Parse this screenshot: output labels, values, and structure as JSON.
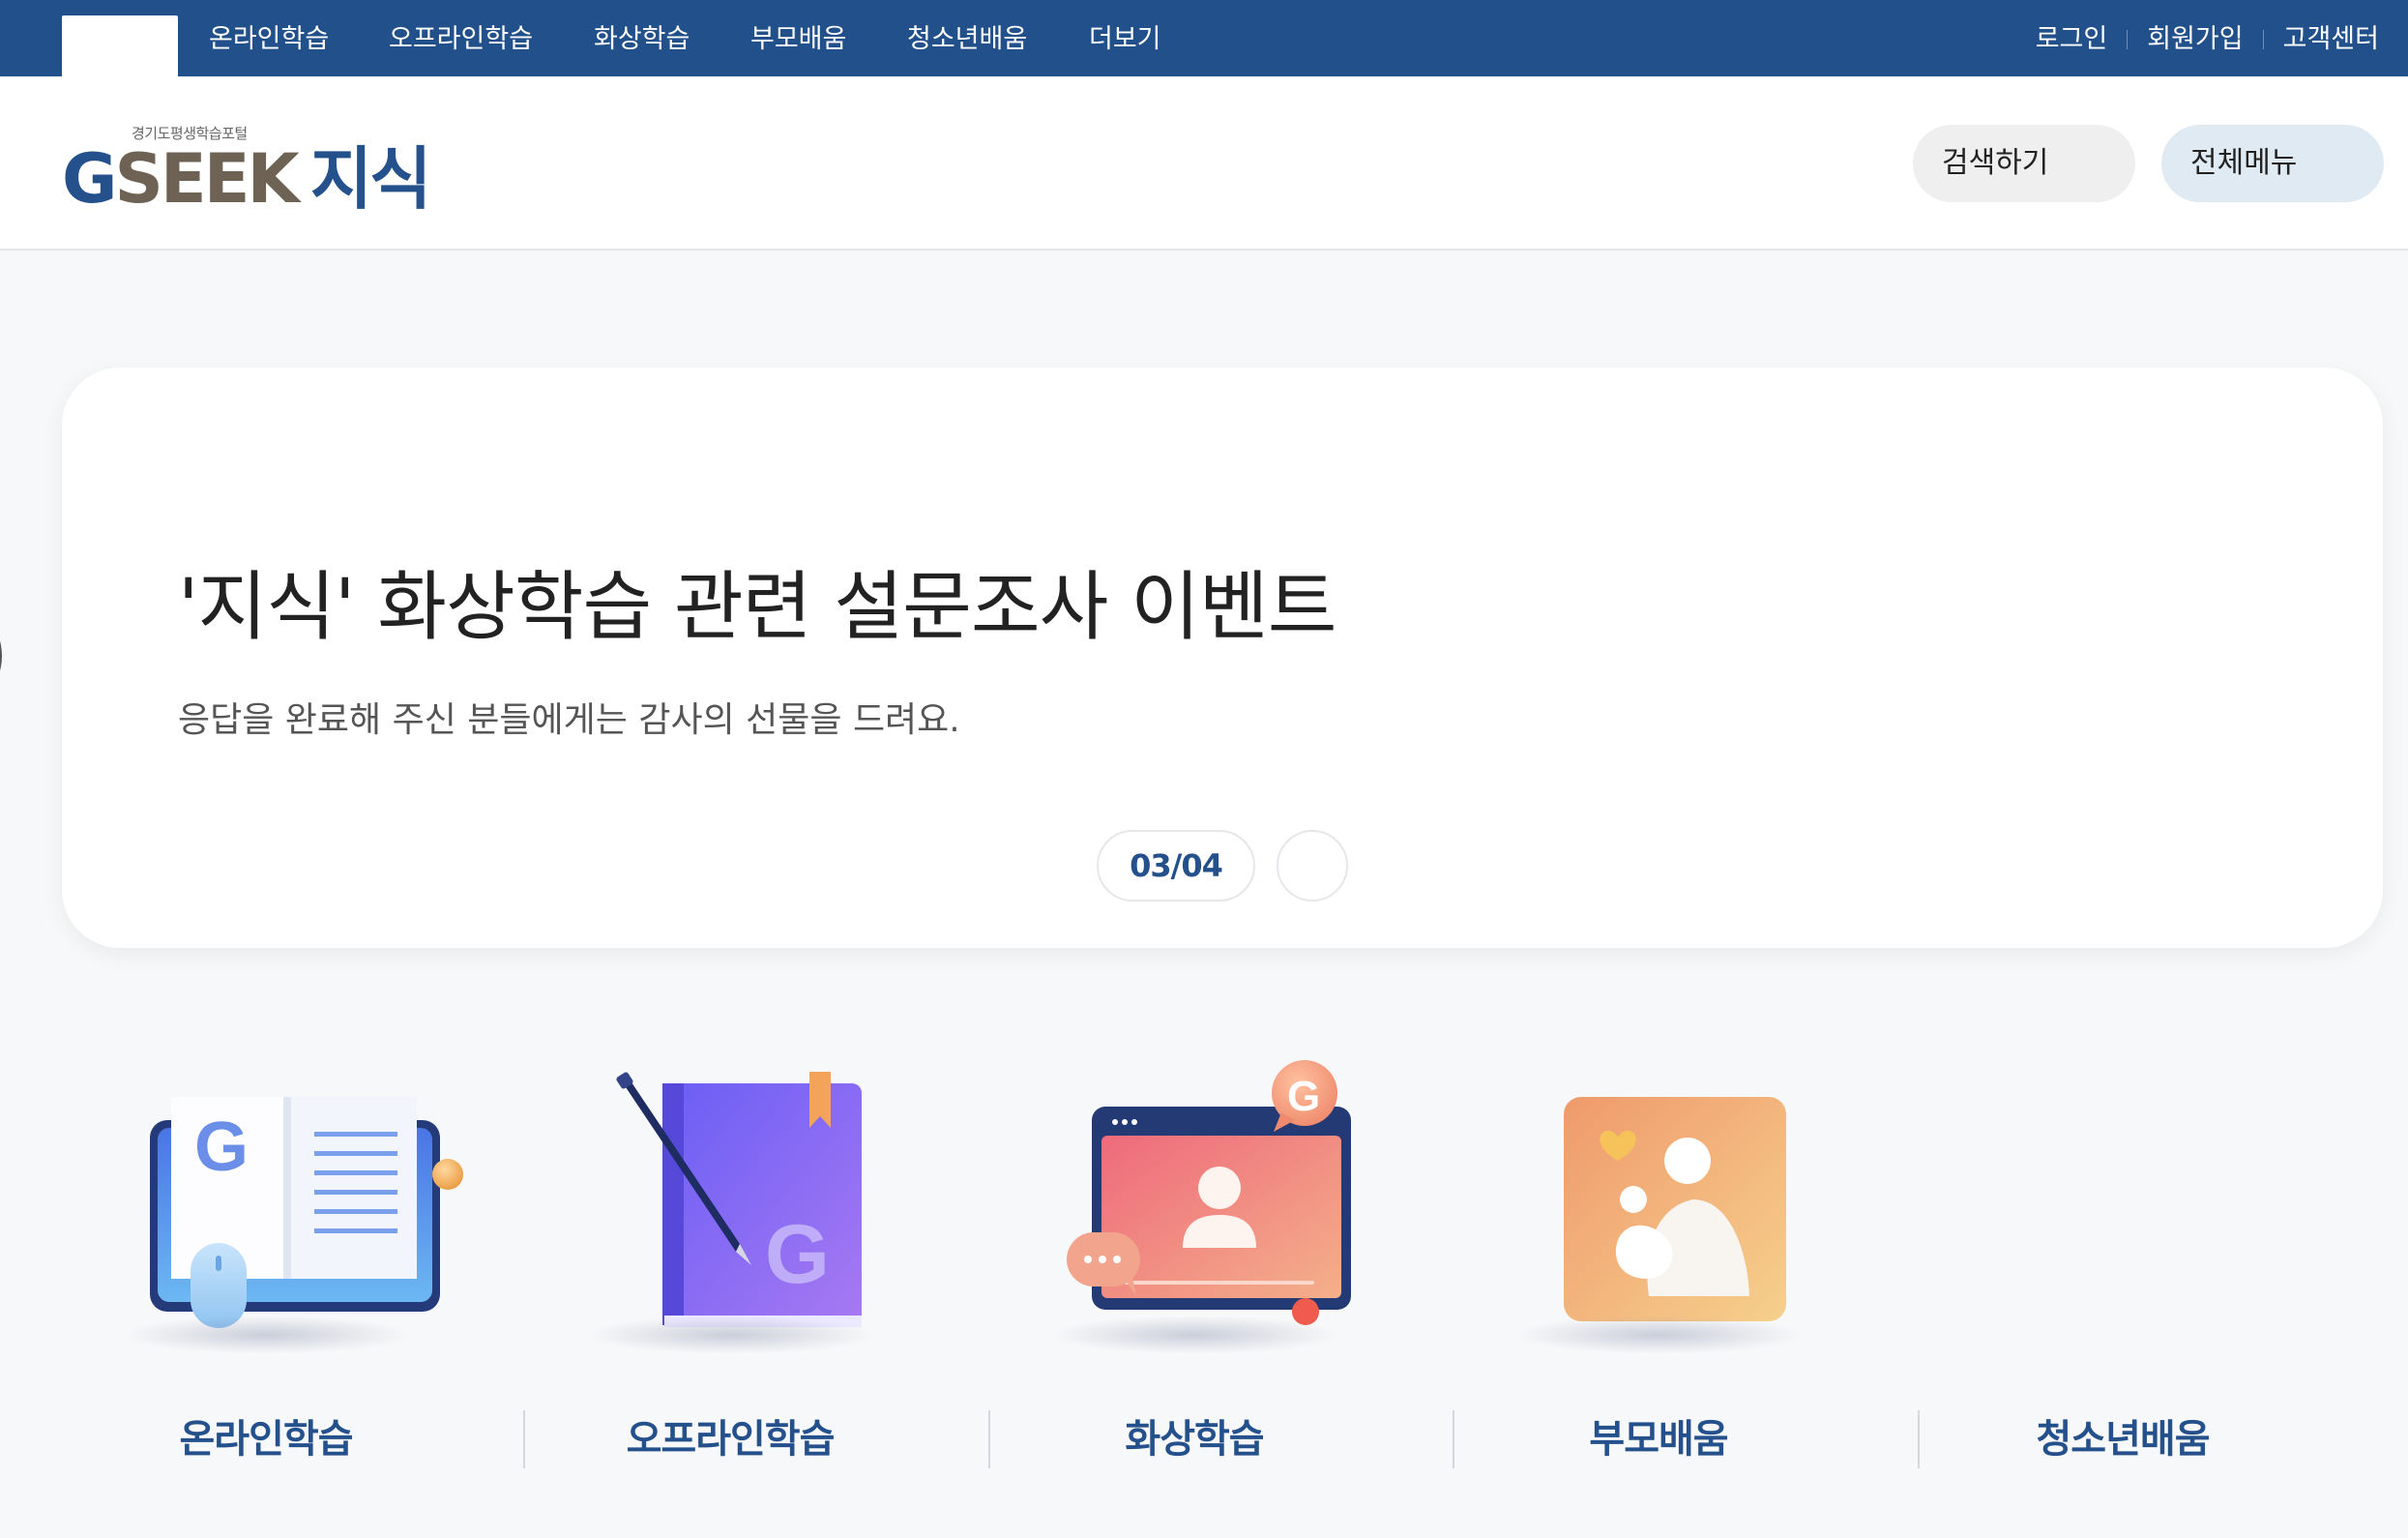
{
  "topbar": {
    "nav": [
      "온라인학습",
      "오프라인학습",
      "화상학습",
      "부모배움",
      "청소년배움",
      "더보기"
    ],
    "util": [
      "로그인",
      "회원가입",
      "고객센터"
    ]
  },
  "header": {
    "logo_sub": "경기도평생학습포털",
    "logo_g": "G",
    "logo_seek": "SEEK",
    "logo_jisik": "지식",
    "search_label": "검색하기",
    "menu_label": "전체메뉴"
  },
  "slide": {
    "headline": "'지식' 화상학습 관련 설문조사 이벤트",
    "subline": "응답을 완료해 주신 분들에게는 감사의 선물을 드려요.",
    "counter": "03/04"
  },
  "categories": [
    "온라인학습",
    "오프라인학습",
    "화상학습",
    "부모배움",
    "청소년배움"
  ],
  "colors": {
    "brand_blue": "#22508a",
    "logo_brown": "#6e6255",
    "background": "#f7f8f9"
  }
}
